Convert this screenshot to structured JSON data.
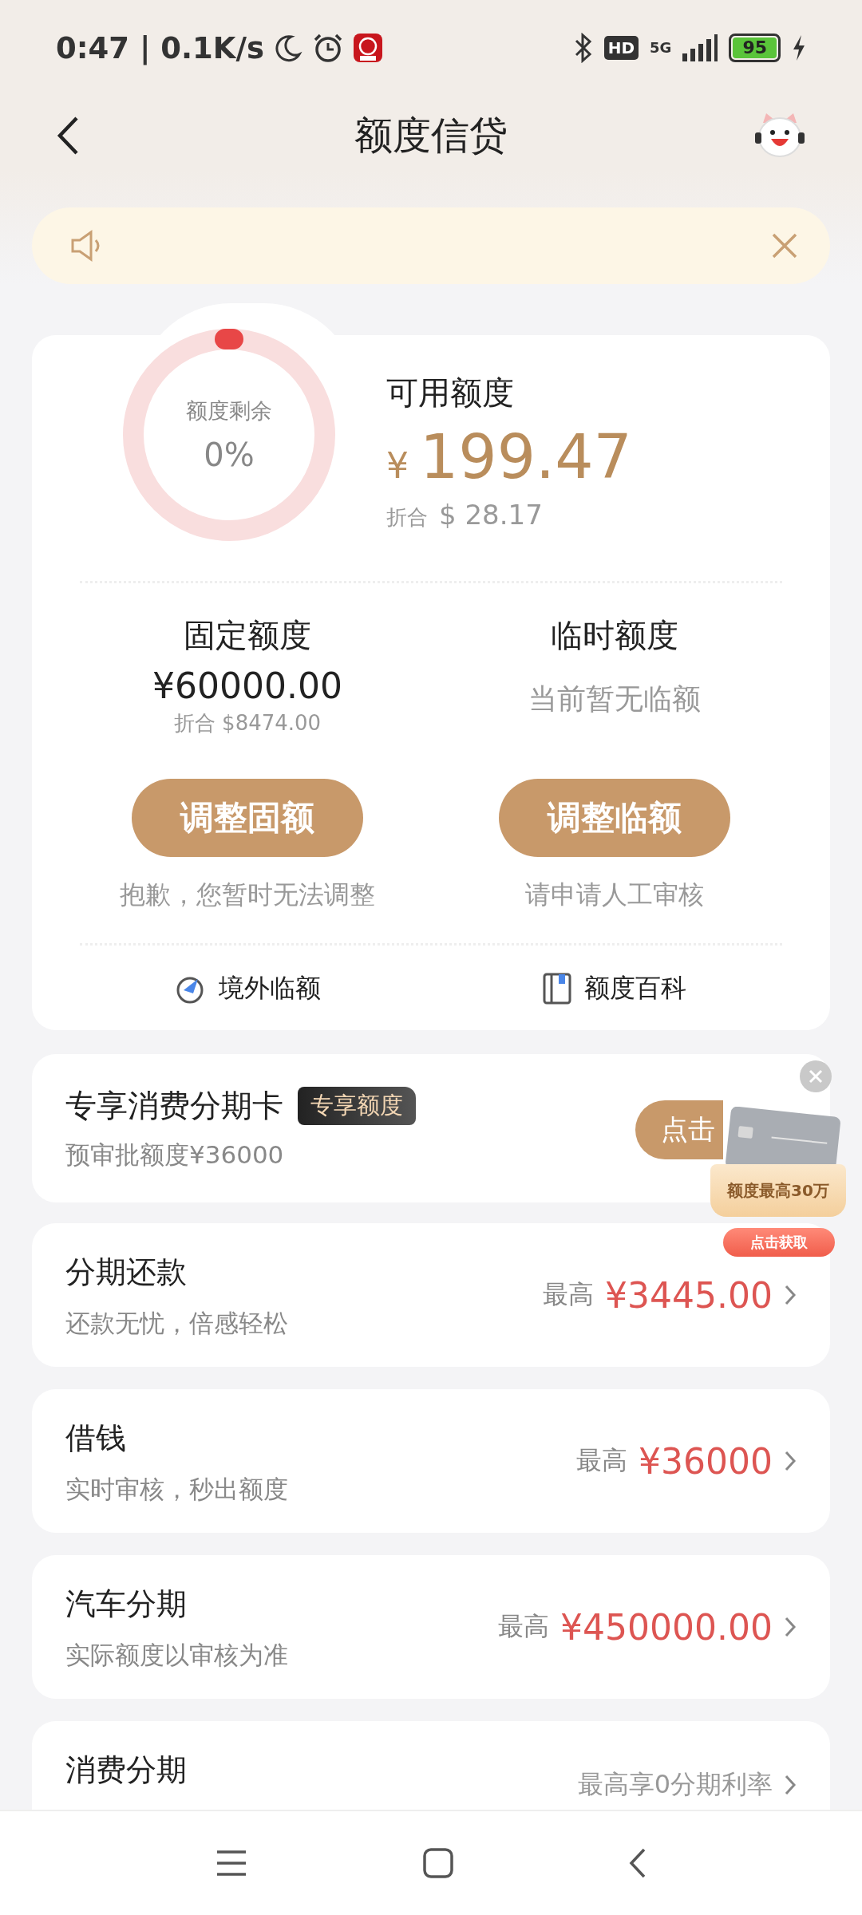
{
  "status_bar": {
    "time": "0:47 | 0.1K/s",
    "hd": "HD",
    "network": "5G",
    "battery": "95"
  },
  "header": {
    "title": "额度信贷"
  },
  "credit": {
    "ring": {
      "label": "额度剩余",
      "percent": "0%",
      "level": 0
    },
    "available_label": "可用额度",
    "currency": "¥",
    "amount": "199.47",
    "converted_label": "折合",
    "converted": "$ 28.17"
  },
  "limits": [
    {
      "title": "固定额度",
      "amount": "¥60000.00",
      "converted": "折合 $8474.00",
      "button": "调整固额",
      "note": "抱歉，您暂时无法调整"
    },
    {
      "title": "临时额度",
      "empty_text": "当前暂无临额",
      "button": "调整临额",
      "note": "请申请人工审核"
    }
  ],
  "links": [
    {
      "label": "境外临额",
      "kind": "overseas"
    },
    {
      "label": "额度百科",
      "kind": "book"
    }
  ],
  "promo": {
    "title": "专享消费分期卡",
    "tag": "专享额度",
    "subtitle": "预审批额度¥36000",
    "button": "点击",
    "ad": {
      "headline": "额度最高30万",
      "button": "点击获取"
    }
  },
  "products": [
    {
      "title": "分期还款",
      "subtitle": "还款无忧，倍感轻松",
      "kind": "amount",
      "prefix": "最高",
      "amount": "¥3445.00"
    },
    {
      "title": "借钱",
      "subtitle": "实时审核，秒出额度",
      "kind": "amount",
      "prefix": "最高",
      "amount": "¥36000"
    },
    {
      "title": "汽车分期",
      "subtitle": "实际额度以审核为准",
      "kind": "amount",
      "prefix": "最高",
      "amount": "¥450000.00"
    },
    {
      "title": "消费分期",
      "kind": "note",
      "note": "最高享0分期利率"
    }
  ]
}
